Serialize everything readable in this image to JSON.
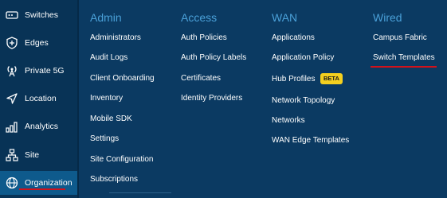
{
  "sidebar": {
    "items": [
      {
        "label": "Switches",
        "icon": "switch-icon"
      },
      {
        "label": "Edges",
        "icon": "edges-icon"
      },
      {
        "label": "Private 5G",
        "icon": "antenna-icon"
      },
      {
        "label": "Location",
        "icon": "location-arrow-icon"
      },
      {
        "label": "Analytics",
        "icon": "bar-chart-icon"
      },
      {
        "label": "Site",
        "icon": "site-icon"
      },
      {
        "label": "Organization",
        "icon": "globe-icon"
      }
    ],
    "active": "Organization"
  },
  "menu": {
    "admin": {
      "title": "Admin",
      "links": [
        "Administrators",
        "Audit Logs",
        "Client Onboarding",
        "Inventory",
        "Mobile SDK",
        "Settings",
        "Site Configuration",
        "Subscriptions"
      ]
    },
    "access": {
      "title": "Access",
      "links": [
        "Auth Policies",
        "Auth Policy Labels",
        "Certificates",
        "Identity Providers"
      ]
    },
    "wan": {
      "title": "WAN",
      "links": [
        "Applications",
        "Application Policy",
        "Hub Profiles",
        "Network Topology",
        "Networks",
        "WAN Edge Templates"
      ],
      "badge": "BETA"
    },
    "wired": {
      "title": "Wired",
      "links": [
        "Campus Fabric",
        "Switch Templates"
      ],
      "highlighted": "Switch Templates"
    }
  },
  "colors": {
    "accent": "#4aa0d8",
    "highlight": "#d0121b",
    "badge": "#f4d01f",
    "panel": "#0b3a62",
    "sidebar": "#083356"
  }
}
